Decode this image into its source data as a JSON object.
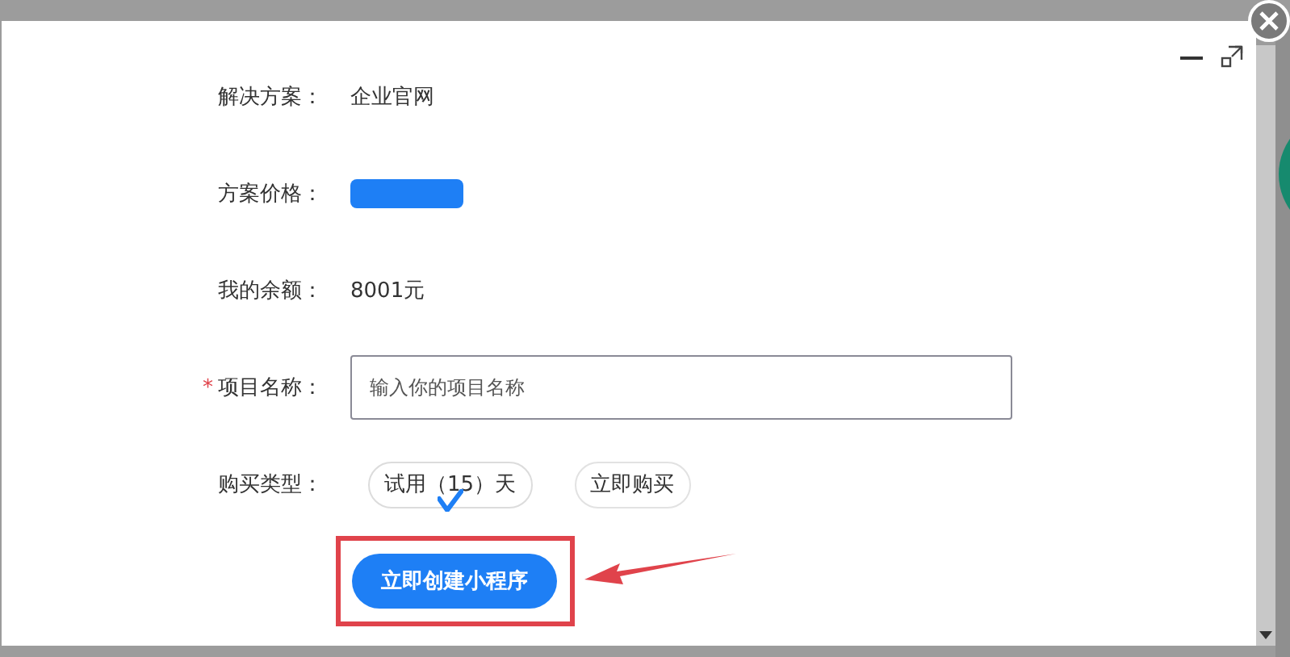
{
  "fields": [
    {
      "label": "解决方案：",
      "kind": "text",
      "required": false,
      "value": "企业官网"
    },
    {
      "label": "方案价格：",
      "kind": "redacted",
      "required": false
    },
    {
      "label": "我的余额：",
      "kind": "text",
      "required": false,
      "value": "8001元"
    },
    {
      "label": "项目名称：",
      "kind": "input",
      "required": true,
      "placeholder": "输入你的项目名称"
    },
    {
      "label": "购买类型：",
      "kind": "options",
      "required": false,
      "options": [
        {
          "label": "试用（15）天",
          "selected": true
        },
        {
          "label": "立即购买",
          "selected": false
        }
      ]
    }
  ],
  "required_mark": "*",
  "submit": "立即创建小程序"
}
